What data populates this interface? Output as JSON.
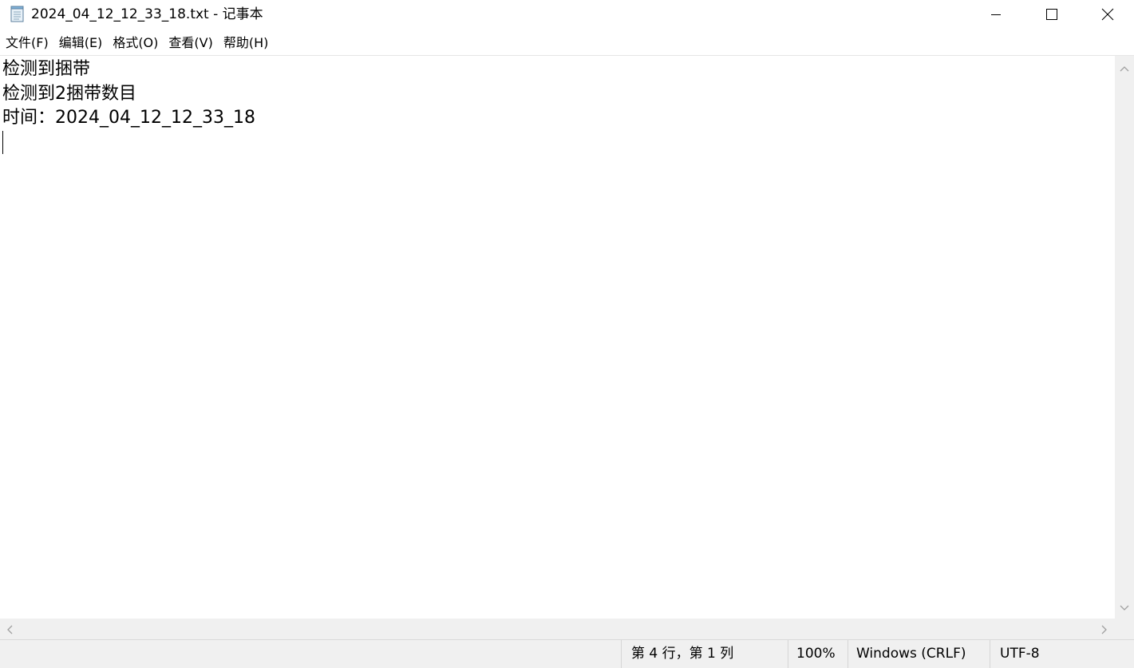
{
  "window": {
    "title": "2024_04_12_12_33_18.txt - 记事本",
    "app_icon": "notepad-icon"
  },
  "menu": {
    "items": [
      {
        "label": "文件(F)"
      },
      {
        "label": "编辑(E)"
      },
      {
        "label": "格式(O)"
      },
      {
        "label": "查看(V)"
      },
      {
        "label": "帮助(H)"
      }
    ]
  },
  "editor": {
    "lines": [
      "检测到捆带",
      "检测到2捆带数目",
      "时间：2024_04_12_12_33_18"
    ]
  },
  "status": {
    "position": "第 4 行，第 1 列",
    "zoom": "100%",
    "line_ending": "Windows (CRLF)",
    "encoding": "UTF-8"
  }
}
